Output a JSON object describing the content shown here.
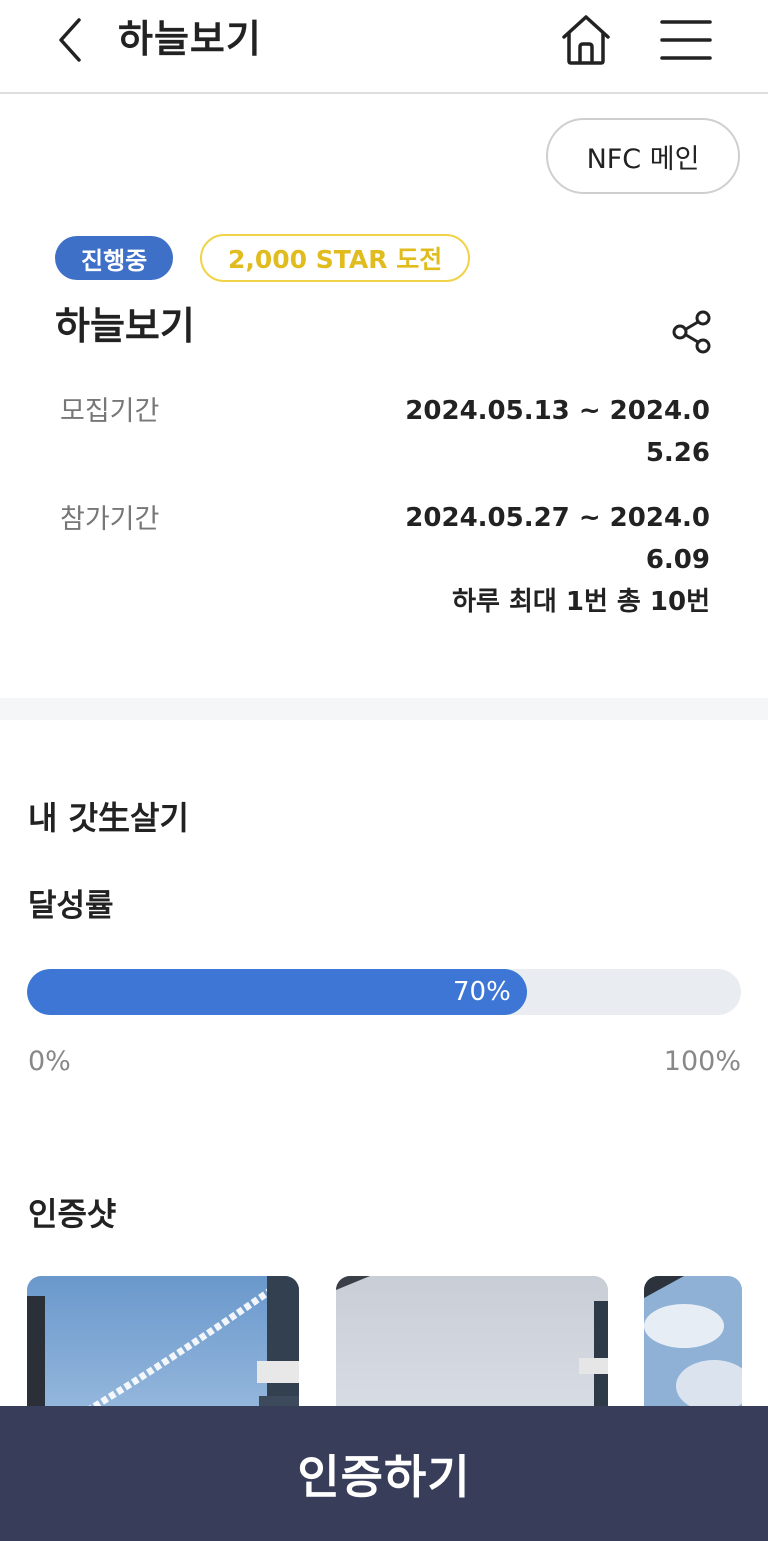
{
  "header": {
    "title": "하늘보기",
    "back_icon": "chevron-left-icon",
    "home_icon": "home-icon",
    "menu_icon": "hamburger-menu-icon"
  },
  "nfc_button": {
    "label": "NFC 메인"
  },
  "challenge": {
    "status_badge": "진행중",
    "star_badge": "2,000 STAR 도전",
    "title": "하늘보기",
    "share_icon": "share-icon",
    "recruit": {
      "label": "모집기간",
      "value": "2024.05.13 ~ 2024.05.26"
    },
    "participate": {
      "label": "참가기간",
      "value": "2024.05.27 ~ 2024.06.09",
      "note": "하루 최대 1번 총 10번"
    }
  },
  "my_section": {
    "title": "내 갓生살기",
    "achievement": {
      "title": "달성률",
      "percent": 70,
      "percent_label": "70%",
      "min_label": "0%",
      "max_label": "100%"
    }
  },
  "photos": {
    "title": "인증샷",
    "items": [
      "sky-photo-contrail",
      "sky-photo-overcast",
      "sky-photo-clouds"
    ]
  },
  "cta": {
    "label": "인증하기"
  },
  "colors": {
    "accent_blue": "#3d76d4",
    "status_badge": "#3f70c8",
    "star_badge": "#f1d34a",
    "cta_background": "#383d5a"
  }
}
